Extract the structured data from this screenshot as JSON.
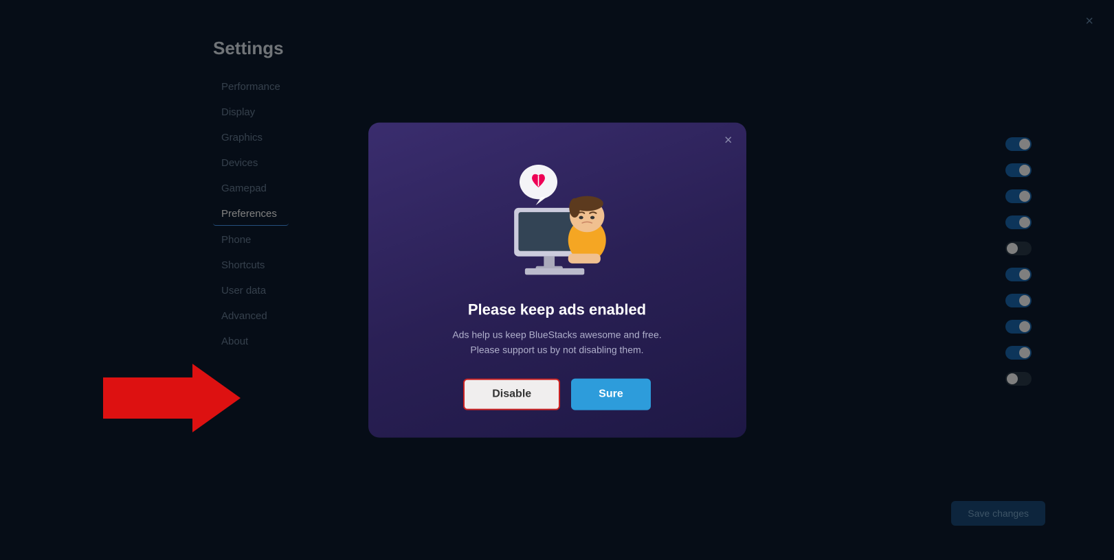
{
  "app": {
    "title": "Settings",
    "close_label": "×"
  },
  "sidebar": {
    "items": [
      {
        "label": "Performance",
        "active": false
      },
      {
        "label": "Display",
        "active": false
      },
      {
        "label": "Graphics",
        "active": false
      },
      {
        "label": "Devices",
        "active": false
      },
      {
        "label": "Gamepad",
        "active": false
      },
      {
        "label": "Preferences",
        "active": true
      },
      {
        "label": "Phone",
        "active": false
      },
      {
        "label": "Shortcuts",
        "active": false
      },
      {
        "label": "User data",
        "active": false
      },
      {
        "label": "Advanced",
        "active": false
      },
      {
        "label": "About",
        "active": false
      }
    ]
  },
  "toggles": [
    {
      "state": "on"
    },
    {
      "state": "on"
    },
    {
      "state": "on"
    },
    {
      "state": "on"
    },
    {
      "state": "off"
    },
    {
      "state": "on"
    },
    {
      "state": "on"
    },
    {
      "state": "on"
    },
    {
      "state": "on"
    },
    {
      "state": "off"
    }
  ],
  "save_button": {
    "label": "Save changes"
  },
  "dialog": {
    "title": "Please keep ads enabled",
    "description": "Ads help us keep BlueStacks awesome and free.\nPlease support us by not disabling them.",
    "disable_label": "Disable",
    "sure_label": "Sure",
    "close_label": "×"
  }
}
